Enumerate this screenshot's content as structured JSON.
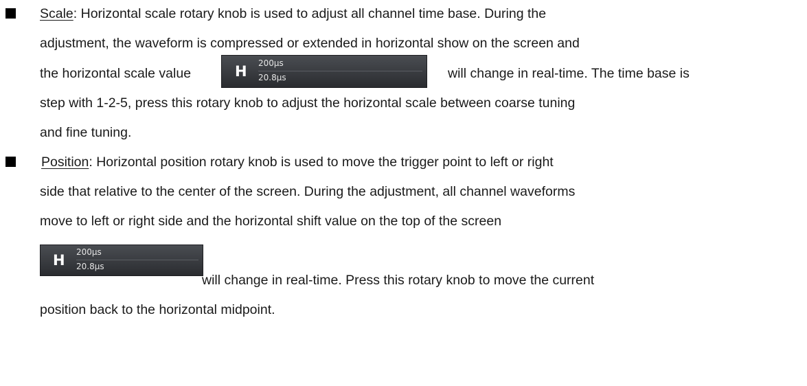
{
  "item1": {
    "term": "Scale",
    "line1_rest": ": Horizontal scale rotary knob is used to adjust all channel time base. During the",
    "line2": "adjustment, the waveform is compressed or extended in horizontal show on the screen and",
    "line3_before": "the horizontal scale value",
    "line3_after": "will change in real-time. The time base is",
    "line4": "step with 1-2-5, press this rotary knob to adjust the horizontal scale between coarse tuning",
    "line5": "and fine tuning."
  },
  "item2": {
    "term": "Position",
    "line1_rest": ": Horizontal position rotary knob is used to move the trigger point to left or right",
    "line2": "side that relative to the center of the screen. During the adjustment, all channel waveforms",
    "line3": "move to left or right side and the horizontal shift value on the top of the screen",
    "line4_after": "will change in real-time. Press this rotary knob to move the current",
    "line5": "position back to the horizontal midpoint."
  },
  "badge": {
    "letter": "H",
    "time_base": "200µs",
    "offset": "20.8µs"
  }
}
